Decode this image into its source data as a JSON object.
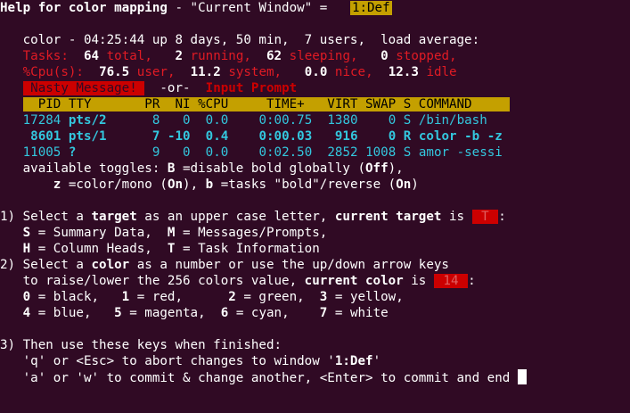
{
  "title": {
    "prefix": "Help for color mapping",
    "mid": " - \"Current Window\" = ",
    "window": "1:Def"
  },
  "summary": {
    "uptime": "color - 04:25:44 up 8 days, 50 min,  7 users,  load average:",
    "tasks": {
      "label": "Tasks:",
      "total": "64",
      "total_label": "total,",
      "running": "2",
      "running_label": "running,",
      "sleeping": "62",
      "sleeping_label": "sleeping,",
      "stopped": "0",
      "stopped_label": "stopped,"
    },
    "cpu": {
      "label": "%Cpu(s):",
      "user": "76.5",
      "user_label": "user,",
      "system": "11.2",
      "system_label": "system,",
      "nice": "0.0",
      "nice_label": "nice,",
      "idle": "12.3",
      "idle_label": "idle"
    },
    "nasty_message": " Nasty Message! ",
    "or": "-or-",
    "input_prompt": "Input Prompt"
  },
  "table": {
    "header": "  PID TTY       PR  NI %CPU     TIME+   VIRT SWAP S COMMAND     ",
    "rows": [
      {
        "pid": "17284",
        "tty": "pts/2",
        "pr": "8",
        "ni": "0",
        "cpu": "0.0",
        "time": "0:00.75",
        "virt": "1380",
        "swap": "0",
        "s": "S",
        "command": "/bin/bash"
      },
      {
        "pid": "8601",
        "tty": "pts/1",
        "pr": "7",
        "ni": "-10",
        "cpu": "0.4",
        "time": "0:00.03",
        "virt": "916",
        "swap": "0",
        "s": "R",
        "command": "color -b -z"
      },
      {
        "pid": "11005",
        "tty": "?",
        "pr": "9",
        "ni": "0",
        "cpu": "0.0",
        "time": "0:02.50",
        "virt": "2852",
        "swap": "1008",
        "s": "S",
        "command": "amor -sessi"
      }
    ]
  },
  "toggles": {
    "intro": "available toggles: ",
    "b_key": "B",
    "b_desc": " =disable bold globally (",
    "b_state": "Off",
    "b_end": "),",
    "z_key": "z",
    "z_desc": " =color/mono (",
    "z_state": "On",
    "z_mid": "), ",
    "b2_key": "b",
    "b2_desc": " =tasks \"bold\"/reverse (",
    "b2_state": "On",
    "b2_end": ")"
  },
  "step1": {
    "num": "1) ",
    "a": "Select a ",
    "target_word": "target",
    "b": " as an upper case letter, ",
    "current_target_label": "current target",
    "c": " is ",
    "target_value": " T ",
    "d": ":",
    "s_key": "S",
    "s_desc": " = Summary Data,  ",
    "m_key": "M",
    "m_desc": " = Messages/Prompts,",
    "h_key": "H",
    "h_desc": " = Column Heads,  ",
    "t_key": "T",
    "t_desc": " = Task Information"
  },
  "step2": {
    "num": "2) ",
    "a": "Select a ",
    "color_word": "color",
    "b": " as a number or use the up/down arrow keys",
    "c": "to raise/lower the 256 colors value, ",
    "current_color_label": "current color",
    "d": " is ",
    "color_value": " 14 ",
    "e": ":",
    "c0": "0",
    "c0l": " = black,   ",
    "c1": "1",
    "c1l": " = red,      ",
    "c2": "2",
    "c2l": " = green,  ",
    "c3": "3",
    "c3l": " = yellow,",
    "c4": "4",
    "c4l": " = blue,   ",
    "c5": "5",
    "c5l": " = magenta,  ",
    "c6": "6",
    "c6l": " = cyan,    ",
    "c7": "7",
    "c7l": " = white"
  },
  "step3": {
    "num": "3) ",
    "a": "Then use these keys when finished:",
    "q_line_a": "'q' or <Esc> to abort changes to window '",
    "q_window": "1:Def",
    "q_line_b": "'",
    "a_line": "'a' or 'w' to commit & change another, <Enter> to commit and end "
  },
  "colors": {
    "background": "#300a24",
    "header_bar": "#c4a000",
    "red": "#cc0000",
    "cyan": "#33c7de"
  }
}
